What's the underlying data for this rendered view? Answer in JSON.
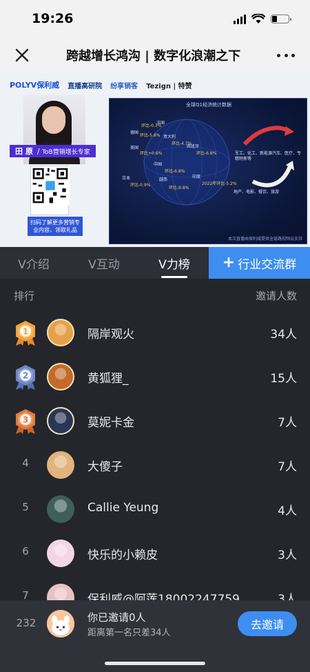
{
  "status_bar": {
    "time": "19:26"
  },
  "nav": {
    "title": "跨越增长鸿沟 | 数字化浪潮之下"
  },
  "video": {
    "logos": [
      "POLYV保利威",
      "直播高研院",
      "纷享销客",
      "Tezign | 特赞"
    ],
    "presenter_name": "田 原",
    "presenter_desc": "ToB营销增长专家",
    "qr_caption": "扫码了解更多营销专业内容，领取礼品",
    "slide_title": "全球Q1经济统计数据",
    "slide_footer": "本次直播由保利威提供全链路视频云支持",
    "slide_labels": [
      "法国",
      "德国",
      "意大利",
      "美国",
      "西班牙",
      "中国",
      "日本",
      "越南",
      "印度",
      "环比-0.3%",
      "环比-5.8%",
      "环比-4.7%",
      "环比+0.6%",
      "环比-6.8%",
      "环比-6.8%",
      "环比-0.9%",
      "环比-9.8%",
      "2022年环比-5.2%",
      "军工、化工、新能源汽车、医疗、专精特新等",
      "地产、电影、餐饮、旅游"
    ]
  },
  "tabs": [
    {
      "label": "V介绍",
      "active": false
    },
    {
      "label": "V互动",
      "active": false
    },
    {
      "label": "V力榜",
      "active": true
    }
  ],
  "join_button": {
    "icon": "plus-icon",
    "label": "行业交流群"
  },
  "list_header": {
    "rank": "排行",
    "count": "邀请人数"
  },
  "rankings": [
    {
      "rank": "1",
      "name": "隔岸观火",
      "count": "34人",
      "medal": "gold",
      "avatar_color": "#e7a04a"
    },
    {
      "rank": "2",
      "name": "黄狐狸_",
      "count": "15人",
      "medal": "silver",
      "avatar_color": "#c46a2a"
    },
    {
      "rank": "3",
      "name": "莫妮卡金",
      "count": "7人",
      "medal": "bronze",
      "avatar_color": "#2a3656"
    },
    {
      "rank": "4",
      "name": "大傻子",
      "count": "7人",
      "medal": "",
      "avatar_color": "#e0b47a"
    },
    {
      "rank": "5",
      "name": "Callie Yeung",
      "count": "4人",
      "medal": "",
      "avatar_color": "#3f5f5a"
    },
    {
      "rank": "6",
      "name": "快乐的小赖皮",
      "count": "3人",
      "medal": "",
      "avatar_color": "#f3d6e6"
    },
    {
      "rank": "7",
      "name": "保利威@阿莲18002247759",
      "count": "3人",
      "medal": "",
      "avatar_color": "#e9c2c2"
    }
  ],
  "my_status": {
    "rank": "232",
    "line1": "你已邀请0人",
    "line2": "距离第一名只差34人",
    "invite_label": "去邀请"
  },
  "colors": {
    "accent": "#3d8ef0",
    "background": "#24262c",
    "gold": "#f2a33a",
    "silver": "#6f86c4",
    "bronze": "#e07b3b"
  }
}
